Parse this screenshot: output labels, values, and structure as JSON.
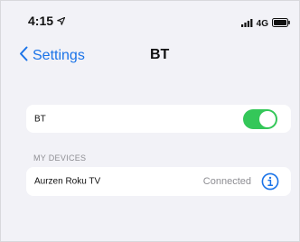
{
  "status_bar": {
    "time": "4:15",
    "network": "4G"
  },
  "nav": {
    "back_label": "Settings",
    "title": "BT"
  },
  "bluetooth": {
    "label": "BT",
    "enabled": true,
    "toggle_color": "#34c759"
  },
  "devices_section": {
    "header": "MY DEVICES",
    "items": [
      {
        "name": "Aurzen Roku TV",
        "status": "Connected"
      }
    ]
  },
  "colors": {
    "accent": "#1a73e8",
    "background": "#f2f2f7"
  }
}
